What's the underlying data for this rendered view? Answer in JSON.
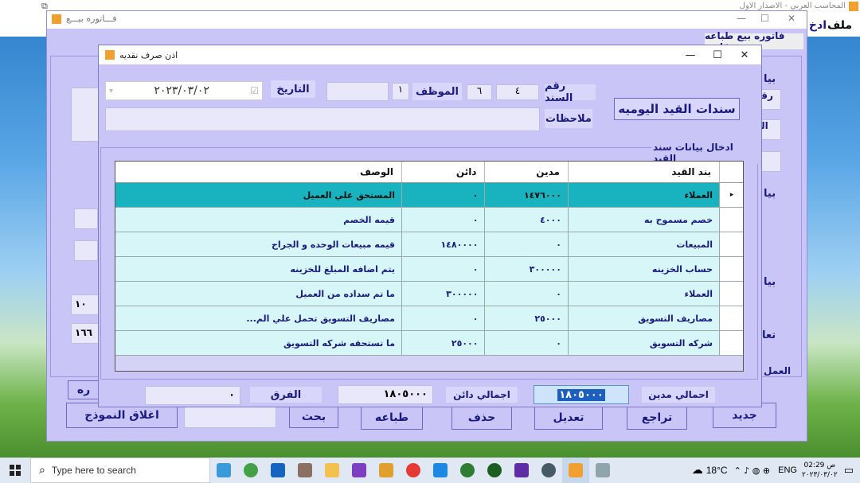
{
  "main_window": {
    "title": "المحاسب العربي - الاصدار الاول",
    "menu": [
      "ملف",
      "ادخ"
    ]
  },
  "invoice_window": {
    "title": "فـــاتوره بيـــع",
    "tab_label": "فاتوره بيع  طباعه تقارير",
    "side_labels": [
      "بيا",
      "رقـ",
      "الـ",
      "ا",
      "بيا",
      "بيا",
      "تعا",
      "العمل"
    ],
    "left_values": [
      "١٠",
      "١٦٦"
    ],
    "left_button_partial": "ره",
    "buttons": {
      "new": "جديد",
      "undo": "تراجع",
      "edit": "تعديل",
      "delete": "حذف",
      "print": "طباعه",
      "search": "بحث",
      "close_form": "اغلاق النموذج"
    }
  },
  "dialog": {
    "title": "اذن صرف نقديه",
    "journal_title": "سندات القيد اليوميه",
    "voucher_no_label": "رقم السند",
    "voucher_no": "٤",
    "voucher_no2": "٦",
    "employee_label": "الموظف",
    "employee": "١",
    "date_label": "التاريخ",
    "date_value": "٢٠٢٣/٠٣/٠٢",
    "notes_label": "ملاحظات",
    "notes_value": "",
    "section_label": "ادخال بيانات سند القيد",
    "columns": [
      "بند القيد",
      "مدين",
      "دائن",
      "الوصف"
    ],
    "rows": [
      {
        "item": "العملاء",
        "debit": "١٤٧٦٠٠٠",
        "credit": "٠",
        "desc": "المستحق علي العميل"
      },
      {
        "item": "خصم مسموح به",
        "debit": "٤٠٠٠",
        "credit": "٠",
        "desc": "قيمه الخصم"
      },
      {
        "item": "المبيعات",
        "debit": "٠",
        "credit": "١٤٨٠٠٠٠",
        "desc": "قيمه مبيعات الوحده و الجراج"
      },
      {
        "item": "حساب الخزينه",
        "debit": "٣٠٠٠٠٠",
        "credit": "٠",
        "desc": "يتم اضافه المبلغ للخزينه"
      },
      {
        "item": "العملاء",
        "debit": "٠",
        "credit": "٣٠٠٠٠٠",
        "desc": "ما تم سداده من العميل"
      },
      {
        "item": "مصاريف التسويق",
        "debit": "٢٥٠٠٠",
        "credit": "٠",
        "desc": "مصاريف التسويق تحمل علي الم..."
      },
      {
        "item": "شركه التسويق",
        "debit": "٠",
        "credit": "٢٥٠٠٠",
        "desc": "ما تستحقه شركه التسويق"
      }
    ],
    "total_debit_label": "احمالي مدين",
    "total_debit": "١٨٠٥٠٠٠",
    "total_credit_label": "اجمالي دائن",
    "total_credit": "١٨٠٥٠٠٠",
    "diff_label": "الفرق",
    "diff": "٠"
  },
  "taskbar": {
    "search_placeholder": "Type here to search",
    "weather": "18°C",
    "lang": "ENG",
    "time": "02:29 ص",
    "date": "٢٠٢٣/٠٣/٠٢"
  }
}
